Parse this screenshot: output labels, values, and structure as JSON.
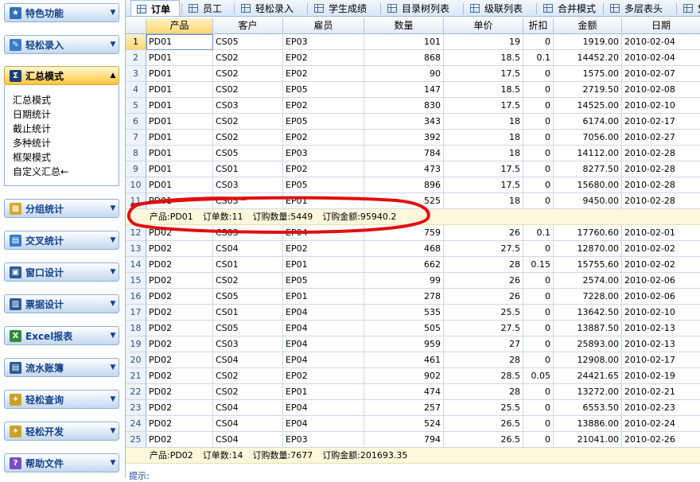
{
  "sidebar": {
    "panels": [
      {
        "label": "特色功能",
        "icon": "star-folder-icon"
      },
      {
        "label": "轻松录入",
        "icon": "edit-form-icon"
      },
      {
        "label": "汇总模式",
        "icon": "sigma-icon"
      },
      {
        "label": "分组统计",
        "icon": "group-stats-icon"
      },
      {
        "label": "交叉统计",
        "icon": "crosstab-icon"
      },
      {
        "label": "窗口设计",
        "icon": "window-design-icon"
      },
      {
        "label": "票据设计",
        "icon": "ticket-design-icon"
      },
      {
        "label": "Excel报表",
        "icon": "excel-icon"
      },
      {
        "label": "流水账簿",
        "icon": "ledger-icon"
      },
      {
        "label": "轻松查询",
        "icon": "query-icon"
      },
      {
        "label": "轻松开发",
        "icon": "develop-icon"
      },
      {
        "label": "帮助文件",
        "icon": "help-icon"
      }
    ],
    "summary_items": [
      "汇总模式",
      "日期统计",
      "截止统计",
      "多种统计",
      "框架模式",
      "自定义汇总←"
    ]
  },
  "tabs": [
    "订单",
    "员工",
    "轻松录入",
    "学生成绩",
    "目录树列表",
    "级联列表",
    "合并模式",
    "多层表头",
    "凭"
  ],
  "grid": {
    "columns": [
      "产品",
      "客户",
      "雇员",
      "数量",
      "单价",
      "折扣",
      "金额",
      "日期"
    ],
    "group1_rows": [
      [
        "1",
        "PD01",
        "CS05",
        "EP03",
        "101",
        "19",
        "0",
        "1919.00",
        "2010-02-04"
      ],
      [
        "2",
        "PD01",
        "CS02",
        "EP02",
        "868",
        "18.5",
        "0.1",
        "14452.20",
        "2010-02-04"
      ],
      [
        "3",
        "PD01",
        "CS02",
        "EP02",
        "90",
        "17.5",
        "0",
        "1575.00",
        "2010-02-07"
      ],
      [
        "4",
        "PD01",
        "CS02",
        "EP05",
        "147",
        "18.5",
        "0",
        "2719.50",
        "2010-02-08"
      ],
      [
        "5",
        "PD01",
        "CS03",
        "EP02",
        "830",
        "17.5",
        "0",
        "14525.00",
        "2010-02-10"
      ],
      [
        "6",
        "PD01",
        "CS02",
        "EP05",
        "343",
        "18",
        "0",
        "6174.00",
        "2010-02-17"
      ],
      [
        "7",
        "PD01",
        "CS02",
        "EP02",
        "392",
        "18",
        "0",
        "7056.00",
        "2010-02-27"
      ],
      [
        "8",
        "PD01",
        "CS05",
        "EP03",
        "784",
        "18",
        "0",
        "14112.00",
        "2010-02-28"
      ],
      [
        "9",
        "PD01",
        "CS01",
        "EP02",
        "473",
        "17.5",
        "0",
        "8277.50",
        "2010-02-28"
      ],
      [
        "10",
        "PD01",
        "CS03",
        "EP05",
        "896",
        "17.5",
        "0",
        "15680.00",
        "2010-02-28"
      ],
      [
        "11",
        "PD01",
        "CS03",
        "EP01",
        "525",
        "18",
        "0",
        "9450.00",
        "2010-02-28"
      ]
    ],
    "summary1": {
      "product": "产品:PD01",
      "orders": "订单数:11",
      "qty": "订购数量:5449",
      "amount": "订购金额:95940.2"
    },
    "group2_rows": [
      [
        "12",
        "PD02",
        "CS03",
        "EP04",
        "759",
        "26",
        "0.1",
        "17760.60",
        "2010-02-01"
      ],
      [
        "13",
        "PD02",
        "CS04",
        "EP02",
        "468",
        "27.5",
        "0",
        "12870.00",
        "2010-02-02"
      ],
      [
        "14",
        "PD02",
        "CS01",
        "EP01",
        "662",
        "28",
        "0.15",
        "15755.60",
        "2010-02-02"
      ],
      [
        "15",
        "PD02",
        "CS02",
        "EP05",
        "99",
        "26",
        "0",
        "2574.00",
        "2010-02-06"
      ],
      [
        "16",
        "PD02",
        "CS05",
        "EP01",
        "278",
        "26",
        "0",
        "7228.00",
        "2010-02-06"
      ],
      [
        "17",
        "PD02",
        "CS01",
        "EP04",
        "535",
        "25.5",
        "0",
        "13642.50",
        "2010-02-10"
      ],
      [
        "18",
        "PD02",
        "CS05",
        "EP04",
        "505",
        "27.5",
        "0",
        "13887.50",
        "2010-02-13"
      ],
      [
        "19",
        "PD02",
        "CS03",
        "EP04",
        "959",
        "27",
        "0",
        "25893.00",
        "2010-02-13"
      ],
      [
        "20",
        "PD02",
        "CS04",
        "EP04",
        "461",
        "28",
        "0",
        "12908.00",
        "2010-02-17"
      ],
      [
        "21",
        "PD02",
        "CS02",
        "EP02",
        "902",
        "28.5",
        "0.05",
        "24421.65",
        "2010-02-19"
      ],
      [
        "22",
        "PD02",
        "CS02",
        "EP01",
        "474",
        "28",
        "0",
        "13272.00",
        "2010-02-21"
      ],
      [
        "23",
        "PD02",
        "CS04",
        "EP04",
        "257",
        "25.5",
        "0",
        "6553.50",
        "2010-02-23"
      ],
      [
        "24",
        "PD02",
        "CS04",
        "EP04",
        "524",
        "26.5",
        "0",
        "13886.00",
        "2010-02-24"
      ],
      [
        "25",
        "PD02",
        "CS04",
        "EP03",
        "794",
        "26.5",
        "0",
        "21041.00",
        "2010-02-26"
      ]
    ],
    "summary2": {
      "product": "产品:PD02",
      "orders": "订单数:14",
      "qty": "订购数量:7677",
      "amount": "订购金额:201693.35"
    }
  },
  "hint": "提示:",
  "colors": {
    "annotation": "#e01010",
    "active_panel": "#ffc541",
    "accent": "#99bbe8"
  }
}
